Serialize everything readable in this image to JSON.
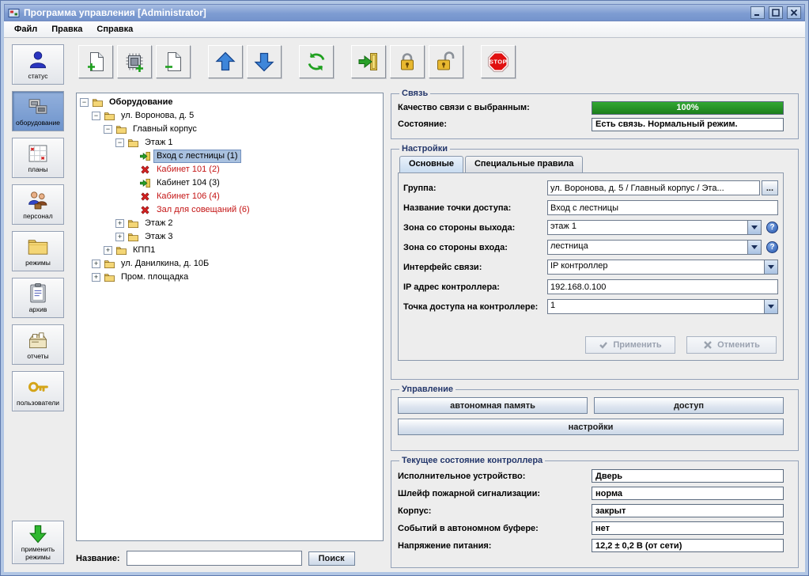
{
  "window": {
    "title": "Программа управления [Administrator]"
  },
  "menubar": {
    "items": [
      "Файл",
      "Правка",
      "Справка"
    ]
  },
  "sidebar": {
    "buttons": [
      {
        "id": "status",
        "icon": "person",
        "label": "статус"
      },
      {
        "id": "equipment",
        "icon": "hardware",
        "label": "оборудование",
        "selected": true
      },
      {
        "id": "plans",
        "icon": "plans",
        "label": "планы"
      },
      {
        "id": "personnel",
        "icon": "personnel",
        "label": "персонал"
      },
      {
        "id": "modes",
        "icon": "folder-big",
        "label": "режимы"
      },
      {
        "id": "archive",
        "icon": "clipboard",
        "label": "архив"
      },
      {
        "id": "reports",
        "icon": "cardbox",
        "label": "отчеты"
      },
      {
        "id": "users",
        "icon": "key",
        "label": "пользователи"
      }
    ],
    "apply_modes": {
      "label": "применить режимы"
    }
  },
  "toolbar": {
    "groups": [
      [
        {
          "id": "add-node",
          "icon": "page-plus"
        },
        {
          "id": "add-controller",
          "icon": "chip-plus"
        },
        {
          "id": "remove-node",
          "icon": "page-minus"
        }
      ],
      [
        {
          "id": "move-up",
          "icon": "arrow-up"
        },
        {
          "id": "move-down",
          "icon": "arrow-down"
        }
      ],
      [
        {
          "id": "refresh",
          "icon": "refresh"
        }
      ],
      [
        {
          "id": "access-point",
          "icon": "access-door"
        },
        {
          "id": "lock",
          "icon": "lock-closed"
        },
        {
          "id": "unlock",
          "icon": "lock-open"
        }
      ],
      [
        {
          "id": "stop",
          "icon": "stop-octagon",
          "label": "STOP"
        }
      ]
    ]
  },
  "tree": {
    "nodes": [
      {
        "label": "Оборудование",
        "level": 0,
        "icon": "folder",
        "bold": true,
        "expander": "open"
      },
      {
        "label": "ул. Воронова, д. 5",
        "level": 1,
        "icon": "folder",
        "expander": "open"
      },
      {
        "label": "Главный корпус",
        "level": 2,
        "icon": "folder",
        "expander": "open"
      },
      {
        "label": "Этаж 1",
        "level": 3,
        "icon": "folder",
        "expander": "open"
      },
      {
        "label": "Вход с лестницы (1)",
        "level": 4,
        "icon": "access-point",
        "selected": true
      },
      {
        "label": "Кабинет 101 (2)",
        "level": 4,
        "icon": "disconnected",
        "red": true
      },
      {
        "label": "Кабинет 104 (3)",
        "level": 4,
        "icon": "access-point"
      },
      {
        "label": "Кабинет 106 (4)",
        "level": 4,
        "icon": "disconnected",
        "red": true
      },
      {
        "label": "Зал для совещаний (6)",
        "level": 4,
        "icon": "disconnected",
        "red": true
      },
      {
        "label": "Этаж 2",
        "level": 3,
        "icon": "folder",
        "expander": "closed"
      },
      {
        "label": "Этаж 3",
        "level": 3,
        "icon": "folder",
        "expander": "closed"
      },
      {
        "label": "КПП1",
        "level": 2,
        "icon": "folder",
        "expander": "closed"
      },
      {
        "label": "ул. Данилкина, д. 10Б",
        "level": 1,
        "icon": "folder",
        "expander": "closed"
      },
      {
        "label": "Пром. площадка",
        "level": 1,
        "icon": "folder",
        "expander": "closed"
      }
    ]
  },
  "search": {
    "label": "Название:",
    "value": "",
    "button_label": "Поиск"
  },
  "panels": {
    "connection": {
      "title": "Связь",
      "quality_label": "Качество связи с выбранным:",
      "quality_percent": 100,
      "quality_value": "100%",
      "state_label": "Состояние:",
      "state_value": "Есть связь. Нормальный режим."
    },
    "settings": {
      "title": "Настройки",
      "tabs": [
        "Основные",
        "Специальные правила"
      ],
      "help_label": "?",
      "fields": [
        {
          "label": "Группа:",
          "value": "ул. Воронова, д. 5 / Главный корпус / Эта...",
          "type": "text-ellipsis",
          "button": "..."
        },
        {
          "label": "Название точки доступа:",
          "value": "Вход с лестницы",
          "type": "text"
        },
        {
          "label": "Зона со стороны выхода:",
          "value": "этаж 1",
          "type": "combo-help"
        },
        {
          "label": "Зона со стороны входа:",
          "value": "лестница",
          "type": "combo-help"
        },
        {
          "label": "Интерфейс связи:",
          "value": "IP контроллер",
          "type": "combo"
        },
        {
          "label": "IP адрес контроллера:",
          "value": "192.168.0.100",
          "type": "text"
        },
        {
          "label": "Точка доступа на контроллере:",
          "value": "1",
          "type": "combo"
        }
      ],
      "apply_label": "Применить",
      "cancel_label": "Отменить"
    },
    "management": {
      "title": "Управление",
      "buttons": [
        "автономная память",
        "доступ",
        "настройки"
      ]
    },
    "controller_state": {
      "title": "Текущее состояние контроллера",
      "fields": [
        {
          "label": "Исполнительное устройство:",
          "value": "Дверь"
        },
        {
          "label": "Шлейф пожарной сигнализации:",
          "value": "норма"
        },
        {
          "label": "Корпус:",
          "value": "закрыт"
        },
        {
          "label": "Событий в автономном буфере:",
          "value": "нет"
        },
        {
          "label": "Напряжение питания:",
          "value": "12,2 ± 0,2 В (от сети)"
        }
      ]
    }
  },
  "colors": {
    "titlebar_blue": "#7E9CD2",
    "progress_green": "#1C7E1C",
    "alarm_red": "#C41414",
    "selection_blue": "#A9C1DF"
  }
}
